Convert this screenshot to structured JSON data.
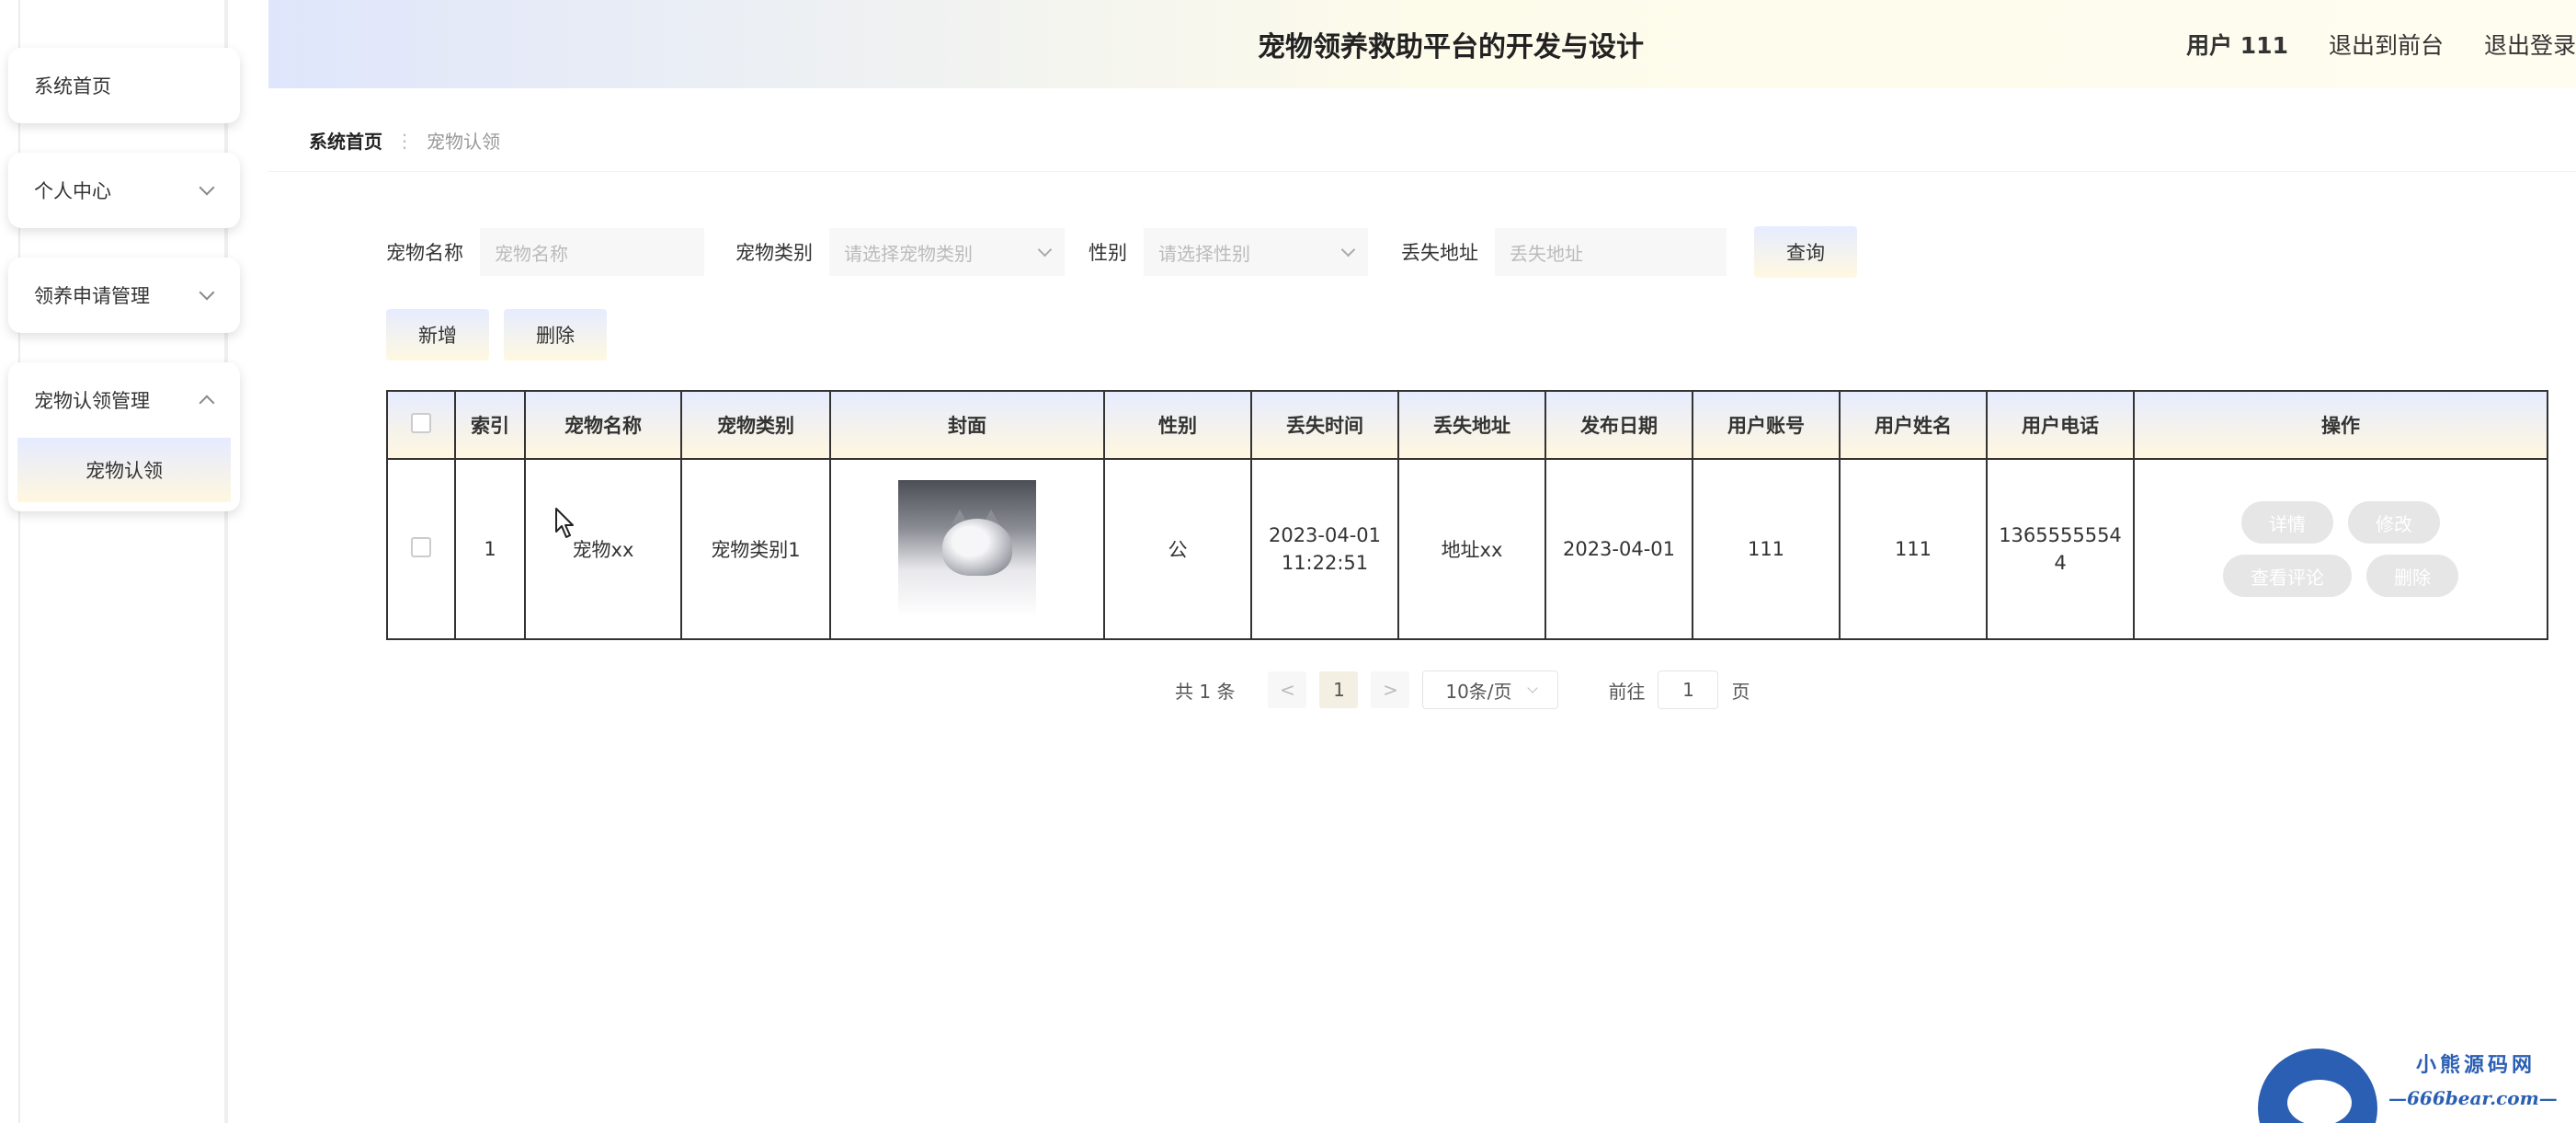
{
  "sidebar": {
    "home": "系统首页",
    "personal_center": "个人中心",
    "adoption_apply_mgmt": "领养申请管理",
    "claim_mgmt": "宠物认领管理",
    "claim_sub": "宠物认领"
  },
  "header": {
    "title": "宠物领养救助平台的开发与设计",
    "user": "用户 111",
    "to_front": "退出到前台",
    "logout": "退出登录"
  },
  "breadcrumb": {
    "home": "系统首页",
    "sep": "⋮",
    "current": "宠物认领"
  },
  "search": {
    "pet_name_label": "宠物名称",
    "pet_name_placeholder": "宠物名称",
    "pet_type_label": "宠物类别",
    "pet_type_placeholder": "请选择宠物类别",
    "gender_label": "性别",
    "gender_placeholder": "请选择性别",
    "lost_addr_label": "丢失地址",
    "lost_addr_placeholder": "丢失地址",
    "query_button": "查询"
  },
  "actions": {
    "add": "新增",
    "delete": "删除"
  },
  "table": {
    "headers": [
      "索引",
      "宠物名称",
      "宠物类别",
      "封面",
      "性别",
      "丢失时间",
      "丢失地址",
      "发布日期",
      "用户账号",
      "用户姓名",
      "用户电话",
      "操作"
    ],
    "rows": [
      {
        "index": "1",
        "pet_name": "宠物xx",
        "pet_type": "宠物类别1",
        "gender": "公",
        "lost_date": "2023-04-01",
        "lost_time": "11:22:51",
        "lost_addr": "地址xx",
        "publish_date": "2023-04-01",
        "account": "111",
        "user_name": "111",
        "phone_a": "1365555554",
        "phone_b": "4",
        "ops": {
          "detail": "详情",
          "edit": "修改",
          "comments": "查看评论",
          "delete": "删除"
        }
      }
    ]
  },
  "pagination": {
    "total": "共 1 条",
    "prev": "<",
    "current": "1",
    "next": ">",
    "page_size": "10条/页",
    "goto_label": "前往",
    "goto_value": "1",
    "page_suffix": "页"
  },
  "watermark": {
    "text1": "小熊源码网",
    "text2": "—666bear.com—"
  }
}
